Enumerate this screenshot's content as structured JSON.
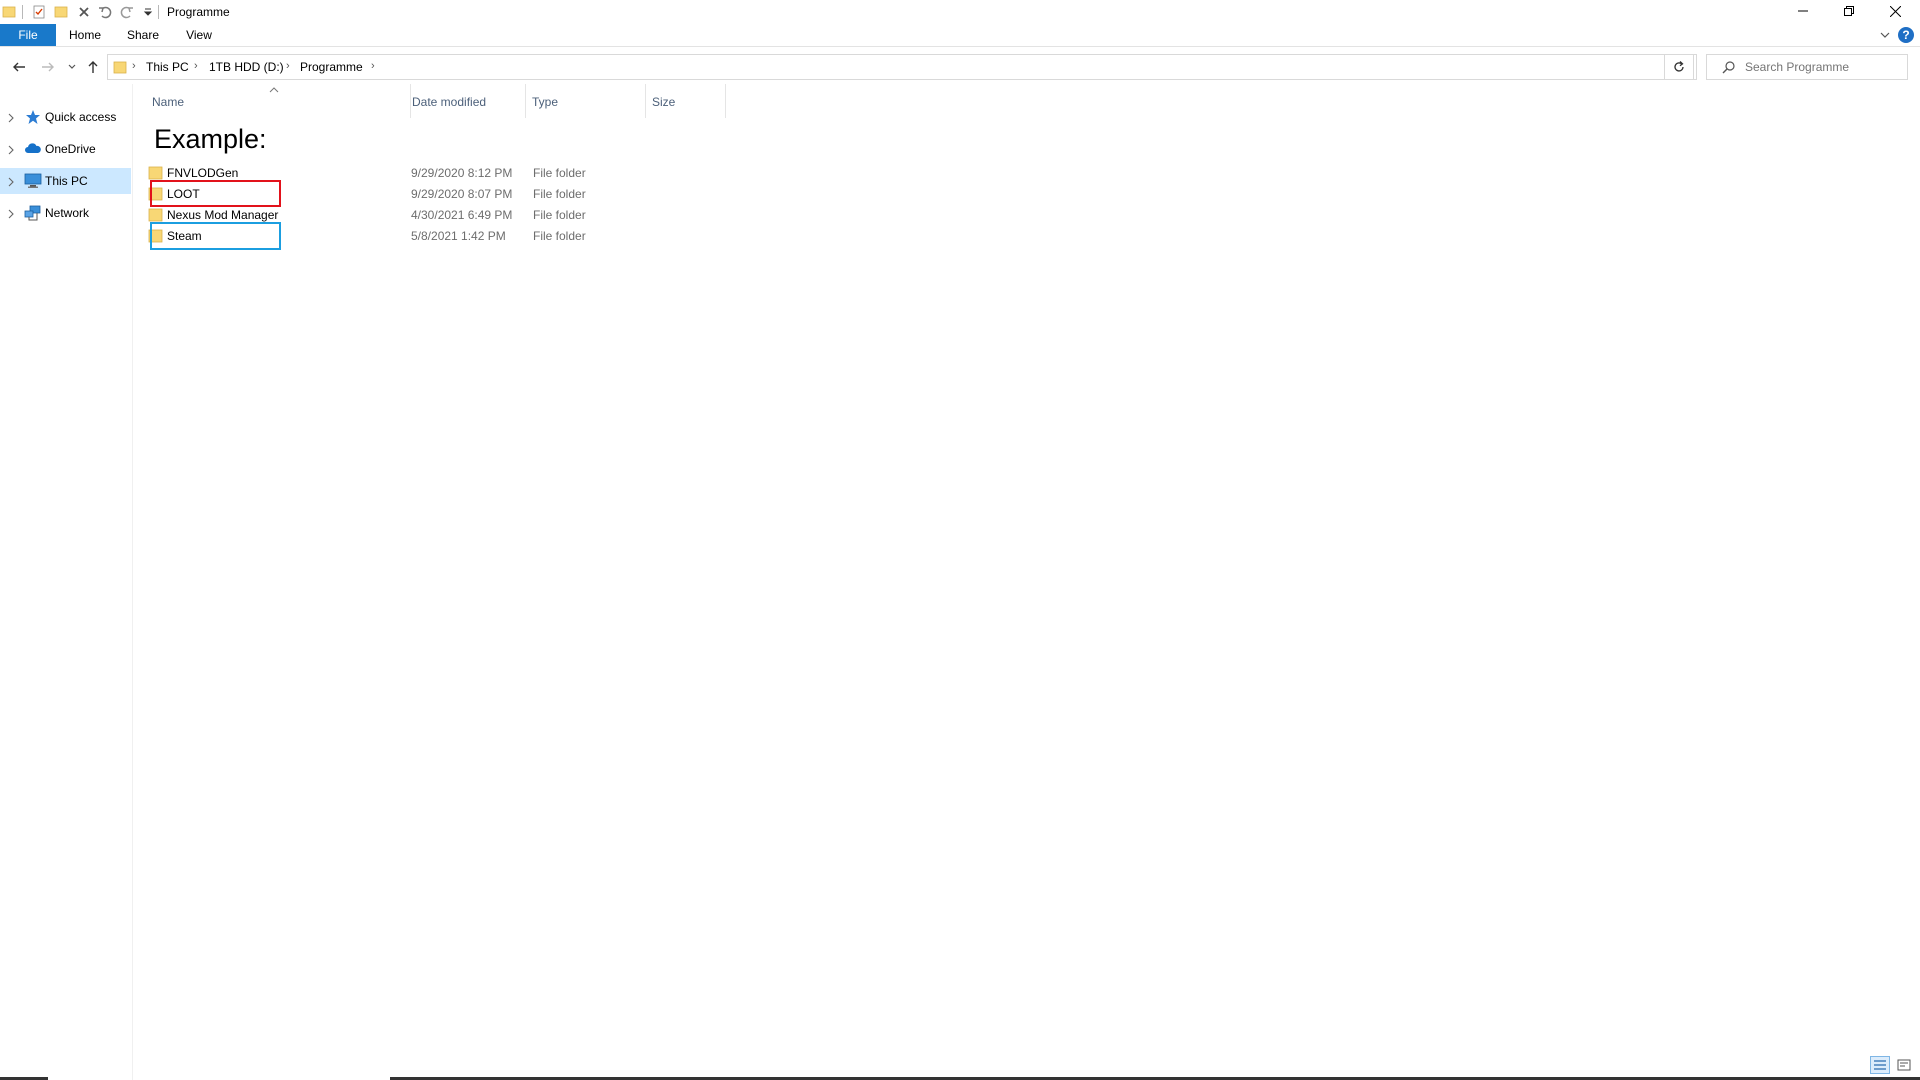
{
  "window": {
    "title": "Programme"
  },
  "ribbon": {
    "tabs": [
      "File",
      "Home",
      "Share",
      "View"
    ],
    "help_label": "?"
  },
  "address": {
    "breadcrumbs": [
      "This PC",
      "1TB HDD (D:)",
      "Programme"
    ]
  },
  "search": {
    "placeholder": "Search Programme"
  },
  "sidebar": {
    "items": [
      {
        "label": "Quick access",
        "icon": "star-icon"
      },
      {
        "label": "OneDrive",
        "icon": "cloud-icon"
      },
      {
        "label": "This PC",
        "icon": "computer-icon",
        "selected": true
      },
      {
        "label": "Network",
        "icon": "network-icon"
      }
    ]
  },
  "columns": [
    "Name",
    "Date modified",
    "Type",
    "Size"
  ],
  "annotation": {
    "example_label": "Example:"
  },
  "files": [
    {
      "name": "FNVLODGen",
      "date": "9/29/2020 8:12 PM",
      "type": "File folder"
    },
    {
      "name": "LOOT",
      "date": "9/29/2020 8:07 PM",
      "type": "File folder",
      "highlight": "red"
    },
    {
      "name": "Nexus Mod Manager",
      "date": "4/30/2021 6:49 PM",
      "type": "File folder"
    },
    {
      "name": "Steam",
      "date": "5/8/2021 1:42 PM",
      "type": "File folder",
      "highlight": "blue"
    }
  ],
  "colors": {
    "accent": "#1979ca",
    "selection": "#cce8ff",
    "folder": "#f8d775",
    "highlight_red": "#e2121b",
    "highlight_blue": "#1b9ee0"
  }
}
